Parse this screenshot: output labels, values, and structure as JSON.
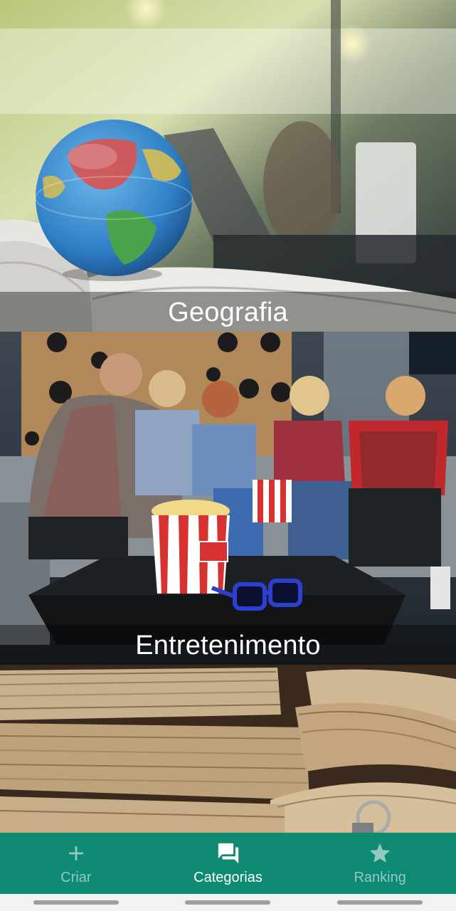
{
  "categories": [
    {
      "label": "Geografia",
      "image": "globe-on-book-photo"
    },
    {
      "label": "Entretenimento",
      "image": "friends-with-popcorn-photo"
    },
    {
      "label": "",
      "image": "old-books-photo"
    }
  ],
  "bottom_nav": {
    "items": [
      {
        "label": "Criar",
        "icon": "plus-icon",
        "active": false
      },
      {
        "label": "Categorias",
        "icon": "chat-bubbles-icon",
        "active": true
      },
      {
        "label": "Ranking",
        "icon": "star-icon",
        "active": false
      }
    ],
    "background": "#0e8a73"
  }
}
